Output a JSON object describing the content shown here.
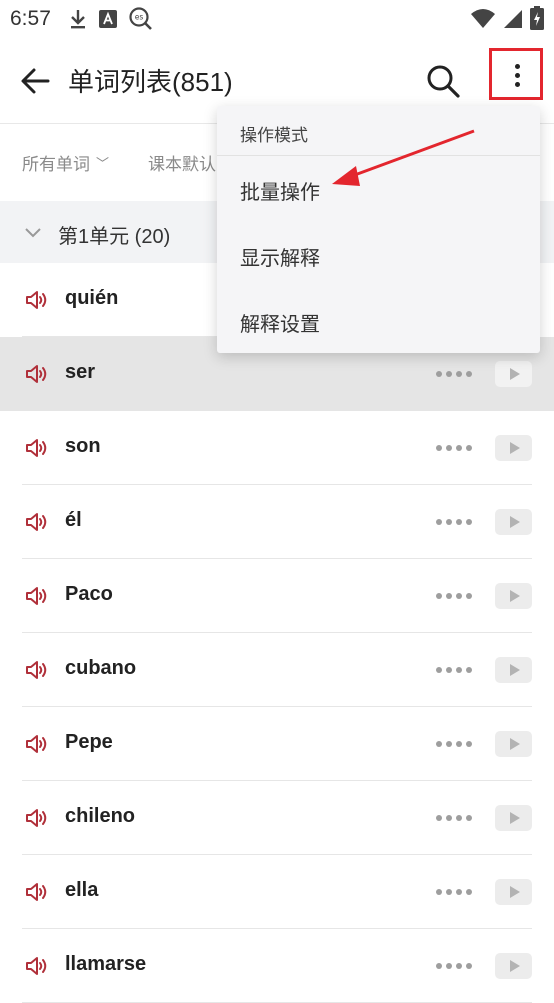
{
  "status_bar": {
    "time": "6:57",
    "left_icons": [
      "download-icon",
      "font-icon",
      "dictionary-search-icon"
    ],
    "dictionary_badge": "es",
    "right_icons": [
      "wifi-icon",
      "signal-icon",
      "battery-charging-icon"
    ]
  },
  "app_bar": {
    "title": "单词列表(851)",
    "back_icon": "arrow-left-icon",
    "search_icon": "search-icon",
    "more_icon": "more-vertical-icon"
  },
  "filters": {
    "all_words": "所有单词",
    "textbook_order": "课本默认"
  },
  "section": {
    "label": "第1单元 (20)"
  },
  "words": [
    {
      "word": "quién"
    },
    {
      "word": "ser",
      "selected": true
    },
    {
      "word": "son"
    },
    {
      "word": "él"
    },
    {
      "word": "Paco"
    },
    {
      "word": "cubano"
    },
    {
      "word": "Pepe"
    },
    {
      "word": "chileno"
    },
    {
      "word": "ella"
    },
    {
      "word": "llamarse"
    }
  ],
  "menu": {
    "header": "操作模式",
    "items": [
      "批量操作",
      "显示解释",
      "解释设置"
    ]
  },
  "colors": {
    "accent_red": "#e3262e",
    "speaker_red": "#b0303a",
    "selected_row": "#e5e5e5",
    "section_bg": "#f2f3f5"
  }
}
